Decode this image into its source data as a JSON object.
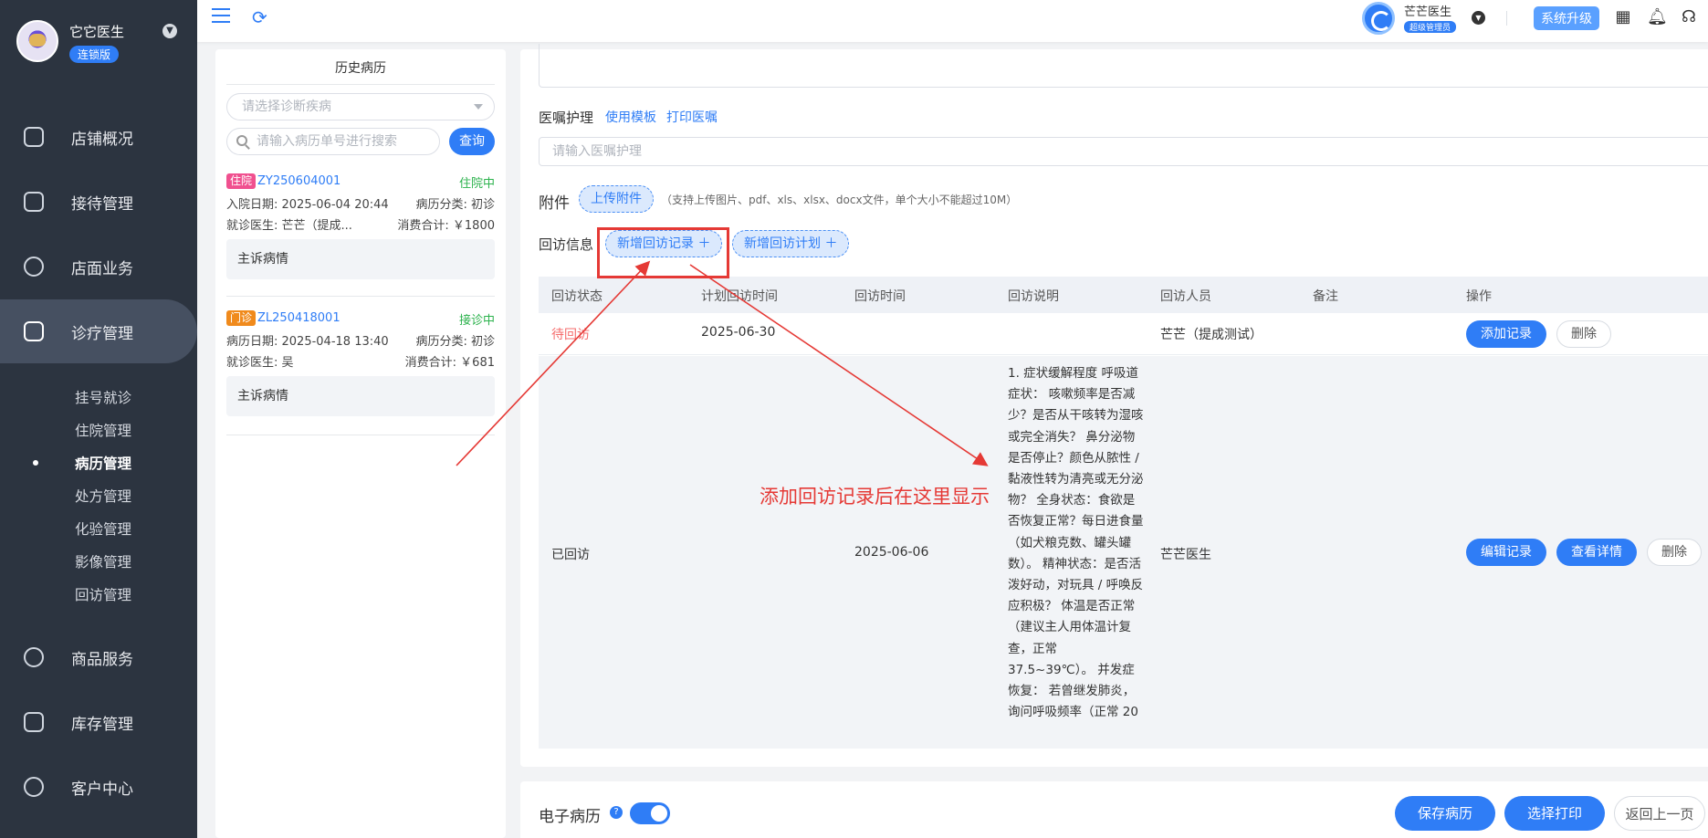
{
  "sidebar": {
    "brand_name": "它它医生",
    "brand_badge": "连锁版",
    "items": [
      {
        "label": "店铺概况",
        "icon": "dashboard-icon"
      },
      {
        "label": "接待管理",
        "icon": "reception-icon"
      },
      {
        "label": "店面业务",
        "icon": "store-icon"
      },
      {
        "label": "诊疗管理",
        "icon": "medical-kit-icon"
      },
      {
        "label": "商品服务",
        "icon": "goods-icon"
      },
      {
        "label": "库存管理",
        "icon": "inventory-icon"
      },
      {
        "label": "客户中心",
        "icon": "customer-icon"
      }
    ],
    "sub_items": [
      "挂号就诊",
      "住院管理",
      "病历管理",
      "处方管理",
      "化验管理",
      "影像管理",
      "回访管理"
    ],
    "active_sub": "病历管理"
  },
  "topbar": {
    "user_name": "芒芒医生",
    "user_role": "超级管理员",
    "upgrade_label": "系统升级"
  },
  "history": {
    "title": "历史病历",
    "select_placeholder": "请选择诊断疾病",
    "search_placeholder": "请输入病历单号进行搜索",
    "query_label": "查询",
    "records": [
      {
        "tag": "住院",
        "tag_color": "#f0508f",
        "code": "ZY250604001",
        "status": "住院中",
        "date": "入院日期: 2025-06-04 20:44",
        "category": "病历分类: 初诊",
        "doctor": "就诊医生: 芒芒（提成...",
        "total": "消费合计: ￥1800",
        "complaint": "主诉病情"
      },
      {
        "tag": "门诊",
        "tag_color": "#f08a1c",
        "code": "ZL250418001",
        "status": "接诊中",
        "date": "病历日期: 2025-04-18 13:40",
        "category": "病历分类: 初诊",
        "doctor": "就诊医生: 吴",
        "total": "消费合计: ￥681",
        "complaint": "主诉病情"
      }
    ]
  },
  "main": {
    "advice_label": "医嘱护理",
    "use_template": "使用模板",
    "print_advice": "打印医嘱",
    "advice_placeholder": "请输入医嘱护理",
    "attachment_label": "附件",
    "upload_label": "上传附件",
    "upload_hint": "（支持上传图片、pdf、xls、xlsx、docx文件，单个大小不能超过10M）",
    "followup_label": "回访信息",
    "add_record_btn": "新增回访记录 ＋",
    "add_plan_btn": "新增回访计划 ＋",
    "table_headers": [
      "回访状态",
      "计划回访时间",
      "回访时间",
      "回访说明",
      "回访人员",
      "备注",
      "操作"
    ],
    "rows": [
      {
        "status": "待回访",
        "status_color": "#f56c6c",
        "planned": "2025-06-30",
        "time": "",
        "desc": "",
        "staff": "芒芒（提成测试）",
        "remark": "",
        "actions": [
          "添加记录",
          "删除"
        ]
      },
      {
        "status": "已回访",
        "status_color": "#333333",
        "planned": "",
        "time": "2025-06-06",
        "desc": "1. 症状缓解程度 呼吸道症状： 咳嗽频率是否减少？是否从干咳转为湿咳或完全消失？ 鼻分泌物是否停止？颜色从脓性 / 黏液性转为清亮或无分泌物？ 全身状态：食欲是否恢复正常？每日进食量（如犬粮克数、罐头罐数）。 精神状态：是否活泼好动，对玩具 / 呼唤反应积极？ 体温是否正常（建议主人用体温计复查，正常 37.5~39℃）。 并发症恢复： 若曾继发肺炎，询问呼吸频率（正常 20",
        "staff": "芒芒医生",
        "remark": "",
        "actions": [
          "编辑记录",
          "查看详情",
          "删除"
        ]
      }
    ],
    "annotation": "添加回访记录后在这里显示"
  },
  "bottom": {
    "emr_label": "电子病历",
    "emr_enabled": true,
    "save_label": "保存病历",
    "print_label": "选择打印",
    "back_label": "返回上一页"
  },
  "colors": {
    "primary": "#2f7df6",
    "sidebar_bg": "#2c3440",
    "annotation": "#e53935"
  }
}
